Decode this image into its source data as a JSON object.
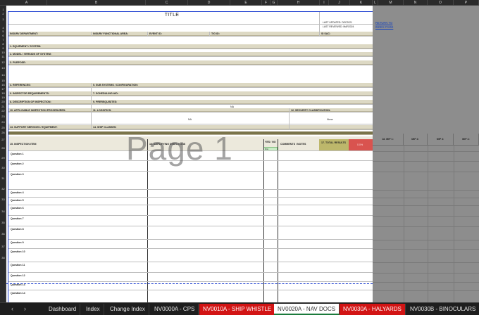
{
  "column_headers": [
    "A",
    "B",
    "C",
    "D",
    "E",
    "F",
    "G",
    "H",
    "I",
    "J",
    "K",
    "L",
    "M",
    "N",
    "O",
    "P"
  ],
  "row_headers": [
    "1",
    "2",
    "3",
    "4",
    "5",
    "6",
    "7",
    "8",
    "9",
    "10",
    "11",
    "12",
    "13",
    "14",
    "15",
    "16",
    "17",
    "18",
    "19",
    "20",
    "21",
    "22",
    "23",
    "24",
    "25",
    "26",
    "27",
    "28",
    "29",
    "30",
    "31",
    "32",
    "33",
    "34",
    "35",
    "36",
    "37",
    "38"
  ],
  "form": {
    "title": "TITLE",
    "last_updated": "LAST UPDATED: DEC2021",
    "last_reviewed": "LAST REVIEWED: MAR2024",
    "insurv_department": "INSURV DEPARTMENT:",
    "insurv_functional_area": "INSURV FUNCTIONAL AREA:",
    "event_id": "EVENT ID:",
    "tig_id": "TIG ID:",
    "si_sac": "SI SAC:",
    "equipment_system": "1. EQUIPMENT / SYSTEM:",
    "model_version": "2. MODEL / VERSION OF SYSTEM:",
    "purpose": "3. PURPOSE:",
    "references": "4. REFERENCES:",
    "sub_systems": "5. SUB SYSTEMS / CONFIGURATION:",
    "inspector_requirements": "6. INSPECTOR REQUIREMENTS:",
    "scheduling_aid": "7. SCHEDULING AID:",
    "description": "8. DESCRIPTION OF INSPECTION:",
    "prerequisites": "9. PREREQUISITES:",
    "na_value_1": "NA",
    "applicable_procedures": "10. APPLICABLE INSPECTION PROCEDURES:",
    "logistics": "11. LOGISTICS:",
    "security_classification": "12. SECURITY CLASSIFICATION:",
    "na_value_2": "NA",
    "none_value": "None",
    "support_services": "13. SUPPORT SERVICES / EQUIPMENT:",
    "ship_classes": "14. SHIP CLASSES:",
    "inspection_item": "15. INSPECTION ITEM",
    "amplifying_directions": "16. AMPLIFYING DIRECTIONS",
    "yes_no": "YES / NO",
    "comments_notes": "COMMENTS / NOTES",
    "total_results": "17. TOTAL RESULTS",
    "red_cell": "0.0%",
    "green_cell": "N/A",
    "mip_headers": [
      "18. MIP 1:",
      "MIP 2:",
      "MIP 3:",
      "MIP 4:"
    ],
    "questions": [
      "Question 1",
      "Question 2",
      "Question 3",
      "Question 4",
      "Question 5",
      "Question 6",
      "Question 7",
      "Question 8",
      "Question 9",
      "Question 10",
      "Question 11",
      "Question 12",
      "Question 13",
      "Question 14"
    ],
    "links": [
      "RETURN TO",
      "INDEX PAGE"
    ]
  },
  "watermark": "Page 1",
  "tabs": {
    "nav_prev": "‹",
    "nav_next": "›",
    "items": [
      {
        "label": "Dashboard",
        "style": "normal"
      },
      {
        "label": "Index",
        "style": "normal"
      },
      {
        "label": "Change Index",
        "style": "normal"
      },
      {
        "label": "NV0000A - CPS",
        "style": "normal"
      },
      {
        "label": "NV0010A - SHIP WHISTLE",
        "style": "red"
      },
      {
        "label": "NV0020A - NAV DOCS",
        "style": "active"
      },
      {
        "label": "NV0030A - HALYARDS",
        "style": "red"
      },
      {
        "label": "NV0030B - BINOCULARS",
        "style": "normal"
      }
    ]
  },
  "colors": {
    "print_area_border": "#1f3fd0",
    "tab_red": "#d21414",
    "header_fill": "#ddd9c4",
    "olive": "#bdb76b",
    "red_cell": "#d9534f"
  }
}
